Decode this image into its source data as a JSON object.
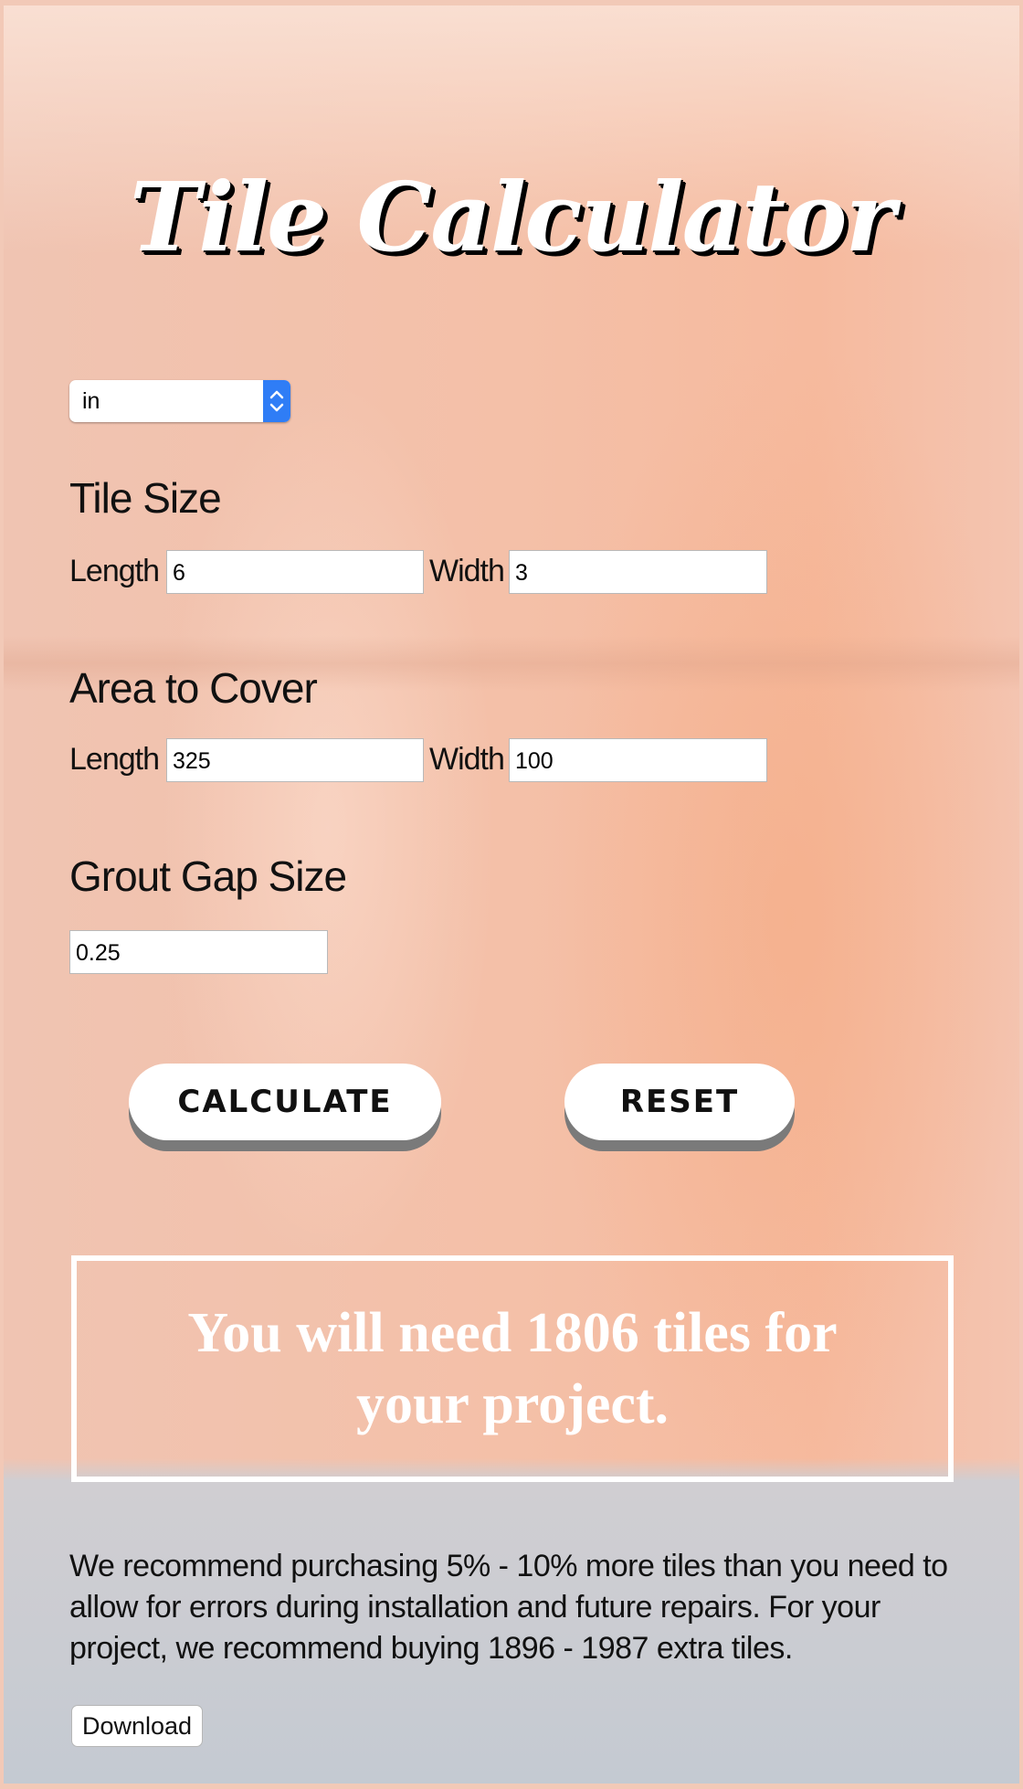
{
  "app": {
    "title": "Tile Calculator"
  },
  "units": {
    "selected": "in"
  },
  "tile_size": {
    "heading": "Tile Size",
    "length_label": "Length",
    "length_value": "6",
    "width_label": "Width",
    "width_value": "3"
  },
  "area": {
    "heading": "Area to Cover",
    "length_label": "Length",
    "length_value": "325",
    "width_label": "Width",
    "width_value": "100"
  },
  "grout": {
    "heading": "Grout Gap Size",
    "value": "0.25"
  },
  "buttons": {
    "calculate": "CALCULATE",
    "reset": "RESET",
    "download": "Download"
  },
  "result": {
    "message": "You will need 1806 tiles for your project."
  },
  "recommendation": {
    "text": "We recommend purchasing 5% - 10% more tiles than you need to allow for errors during installation and future repairs. For your project, we recommend buying 1896 - 1987 extra tiles."
  },
  "colors": {
    "background": "#f4c1a9",
    "footer_band": "#cdcdd2",
    "select_accent": "#2f7df6",
    "button_shadow": "#7a7a7a"
  }
}
